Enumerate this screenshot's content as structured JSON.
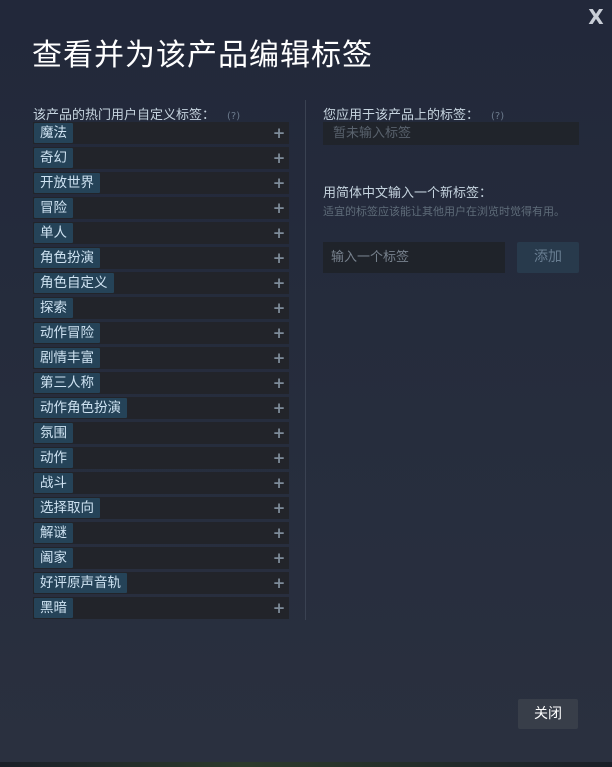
{
  "dialog": {
    "close_glyph": "X",
    "title": "查看并为该产品编辑标签"
  },
  "popular": {
    "label": "该产品的热门用户自定义标签：",
    "help": "(?)",
    "add_glyph": "+",
    "tags": [
      "魔法",
      "奇幻",
      "开放世界",
      "冒险",
      "单人",
      "角色扮演",
      "角色自定义",
      "探索",
      "动作冒险",
      "剧情丰富",
      "第三人称",
      "动作角色扮演",
      "氛围",
      "动作",
      "战斗",
      "选择取向",
      "解谜",
      "阖家",
      "好评原声音轨",
      "黑暗"
    ]
  },
  "applied": {
    "label": "您应用于该产品上的标签：",
    "help": "(?)",
    "empty_text": "暂未输入标签"
  },
  "new_tag": {
    "label": "用简体中文输入一个新标签：",
    "hint": "适宜的标签应该能让其他用户在浏览时觉得有用。",
    "placeholder": "输入一个标签",
    "add_label": "添加"
  },
  "footer": {
    "close_label": "关闭"
  },
  "colors": {
    "background": "#262d3d",
    "tag_pill": "#254358",
    "tag_row": "#22242a",
    "add_button": "#283a4c",
    "close_button": "#383e49"
  }
}
